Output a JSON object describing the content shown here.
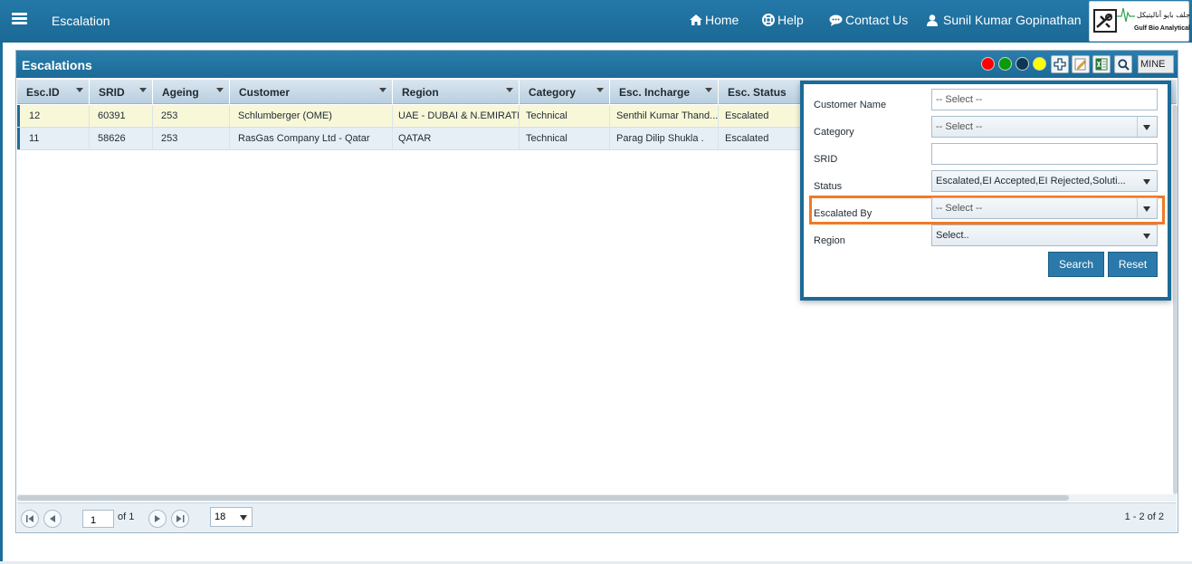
{
  "topbar": {
    "title": "Escalation",
    "home": "Home",
    "help": "Help",
    "contact": "Contact Us",
    "user": "Sunil Kumar Gopinathan",
    "logo_arabic": "جلف بايو أناليتيكل",
    "logo_english": "Gulf Bio Analytical"
  },
  "panel": {
    "title": "Escalations",
    "toolbar": {
      "status_colors": [
        "#ff0000",
        "#0a9b0a",
        "#0c3756",
        "#ffff00"
      ],
      "mine_label": "MINE"
    }
  },
  "grid": {
    "columns": [
      "Esc.ID",
      "SRID",
      "Ageing",
      "Customer",
      "Region",
      "Category",
      "Esc. Incharge",
      "Esc. Status"
    ],
    "rows": [
      [
        "12",
        "60391",
        "253",
        "Schlumberger (OME)",
        "UAE - DUBAI & N.EMIRATES",
        "Technical",
        "Senthil Kumar Thand...",
        "Escalated"
      ],
      [
        "11",
        "58626",
        "253",
        "RasGas Company Ltd - Qatar",
        "QATAR",
        "Technical",
        "Parag Dilip Shukla .",
        "Escalated"
      ]
    ],
    "row_colors": [
      "#f8f8d8",
      "#e6eff6"
    ]
  },
  "pager": {
    "page": "1",
    "of": "of 1",
    "page_size": "18",
    "info": "1 - 2 of 2"
  },
  "search": {
    "customer_label": "Customer Name",
    "customer_placeholder": "-- Select --",
    "category_label": "Category",
    "category_value": "-- Select --",
    "srid_label": "SRID",
    "srid_value": "",
    "status_label": "Status",
    "status_value": "Escalated,EI Accepted,EI Rejected,Soluti...",
    "escalated_by_label": "Escalated By",
    "escalated_by_value": "-- Select --",
    "region_label": "Region",
    "region_value": "Select..",
    "search_btn": "Search",
    "reset_btn": "Reset",
    "highlight_color": "#f07a26"
  }
}
